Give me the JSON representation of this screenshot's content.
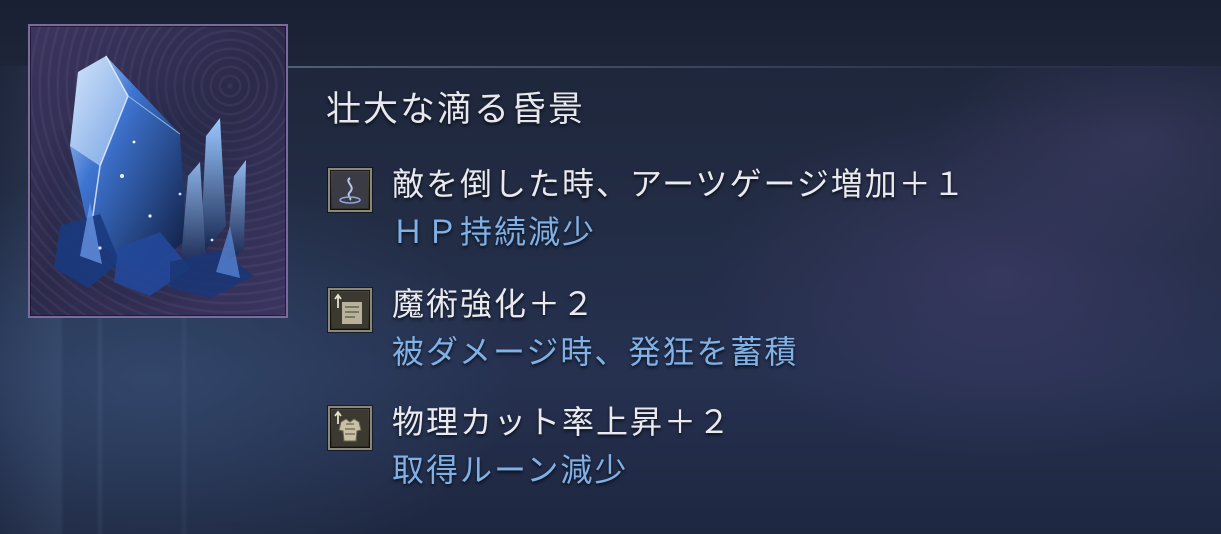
{
  "item": {
    "name": "壮大な滴る昏景",
    "image": "crystal-relic-icon"
  },
  "effects": [
    {
      "icon": "arts-gauge-icon",
      "text": "敵を倒した時、アーツゲージ増加＋１",
      "drawback": "ＨＰ持続減少"
    },
    {
      "icon": "sorcery-scroll-icon",
      "text": "魔術強化＋２",
      "drawback": "被ダメージ時、発狂を蓄積"
    },
    {
      "icon": "armor-icon",
      "text": "物理カット率上昇＋２",
      "drawback": "取得ルーン減少"
    }
  ],
  "colors": {
    "frame_border": "#7a6a9e",
    "effect_text": "#e9eaf0",
    "drawback_text": "#7fb0e6",
    "icon_border": "#8c8878"
  }
}
